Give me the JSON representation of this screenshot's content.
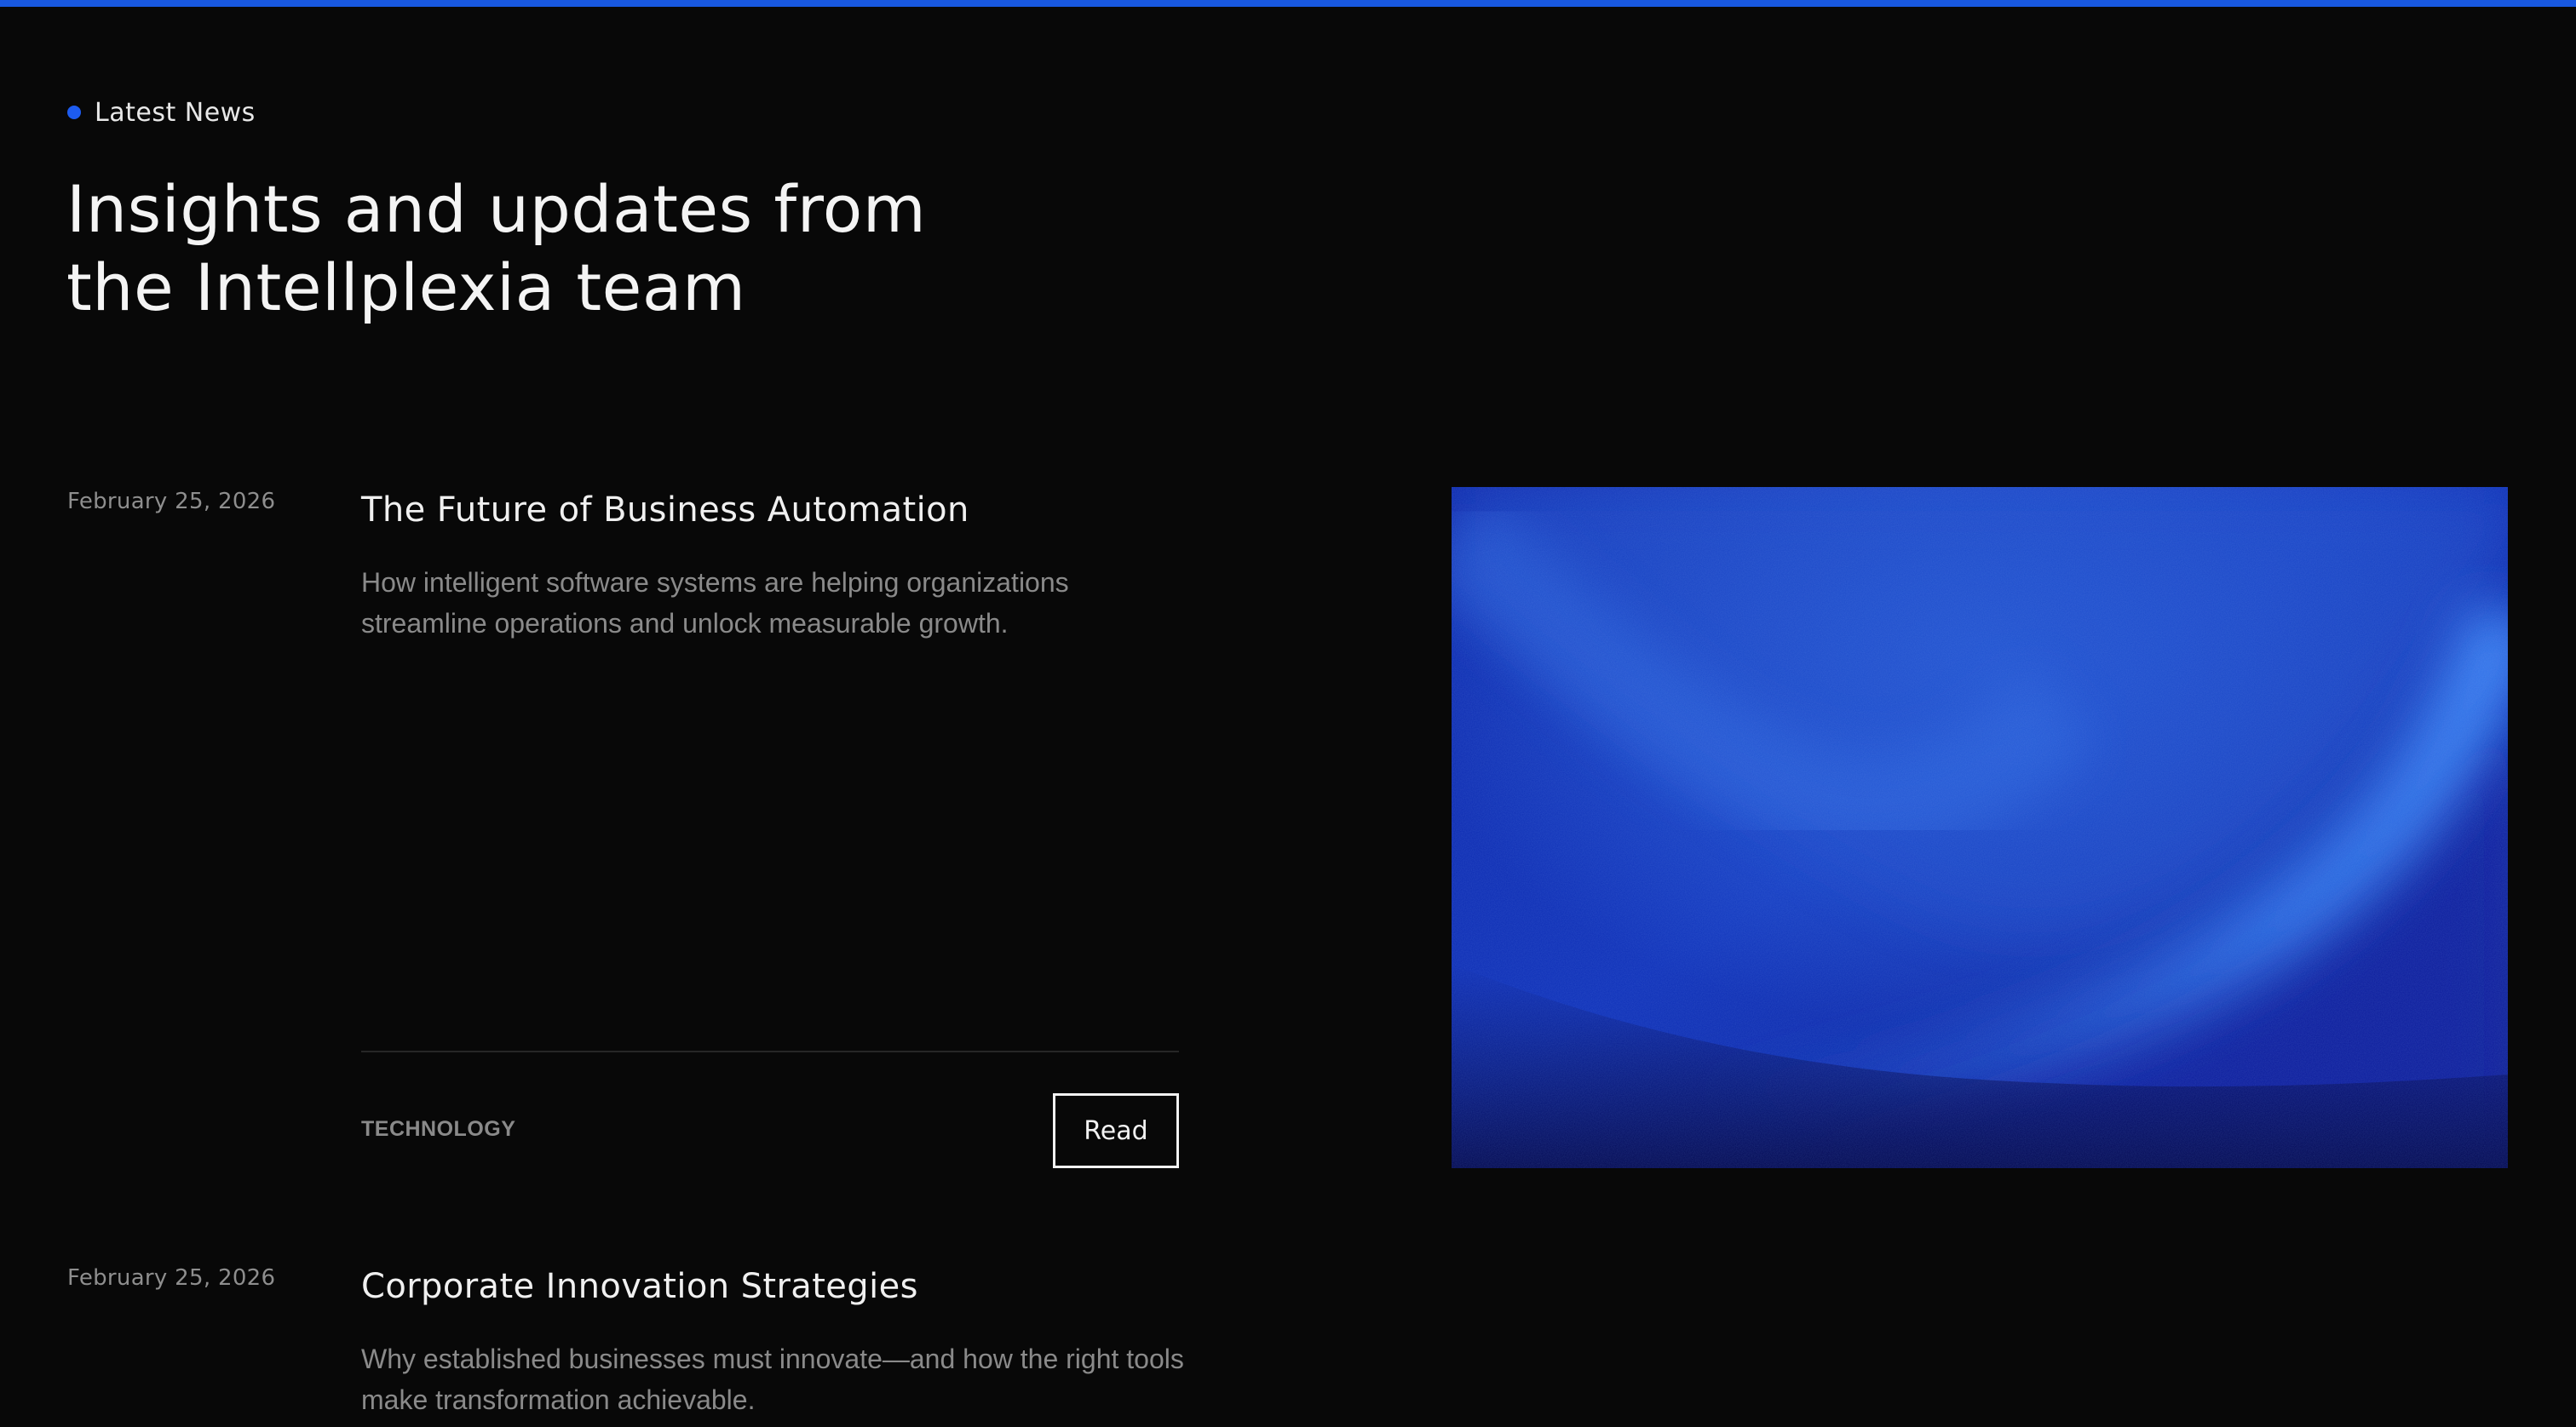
{
  "colors": {
    "accent": "#1858e0",
    "background": "#080808",
    "image_blue_dark": "#051070",
    "image_blue_light": "#2d6fe0"
  },
  "section": {
    "eyebrow": "Latest News",
    "headline_line1": "Insights and updates from",
    "headline_line2": "the Intellplexia team"
  },
  "articles": [
    {
      "date": "February 25, 2026",
      "title": "The Future of Business Automation",
      "excerpt": "How intelligent software systems are helping organizations streamline operations and unlock measurable growth.",
      "category": "TECHNOLOGY",
      "read_label": "Read",
      "image": "abstract-blue-fabric-wave"
    },
    {
      "date": "February 25, 2026",
      "title": "Corporate Innovation Strategies",
      "excerpt": "Why established businesses must innovate—and how the right tools make transformation achievable."
    }
  ]
}
